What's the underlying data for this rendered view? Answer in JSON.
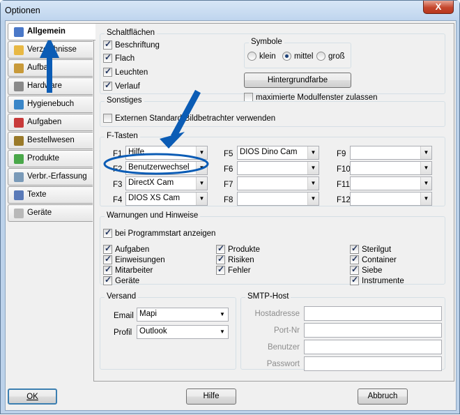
{
  "window": {
    "title": "Optionen",
    "close_glyph": "X"
  },
  "tabs": [
    {
      "label": "Allgemein",
      "icon": "checkmark-document-icon",
      "color": "#4a78c8"
    },
    {
      "label": "Verzeichnisse",
      "icon": "folder-icon",
      "color": "#e8b844"
    },
    {
      "label": "Aufbau",
      "icon": "download-icon",
      "color": "#c89a3a"
    },
    {
      "label": "Hardware",
      "icon": "gear-icon",
      "color": "#8a8a8a"
    },
    {
      "label": "Hygienebuch",
      "icon": "globe-icon",
      "color": "#3a86c8"
    },
    {
      "label": "Aufgaben",
      "icon": "flag-icon",
      "color": "#c83a3a"
    },
    {
      "label": "Bestellwesen",
      "icon": "box-icon",
      "color": "#9a7a2a"
    },
    {
      "label": "Produkte",
      "icon": "cube-icon",
      "color": "#4aa84a"
    },
    {
      "label": "Verbr.-Erfassung",
      "icon": "cart-icon",
      "color": "#7a9ab8"
    },
    {
      "label": "Texte",
      "icon": "document-icon",
      "color": "#5a7ab8"
    },
    {
      "label": "Geräte",
      "icon": "device-icon",
      "color": "#b8b8b8"
    }
  ],
  "schalt": {
    "title": "Schaltflächen",
    "items": [
      {
        "label": "Beschriftung",
        "checked": true
      },
      {
        "label": "Flach",
        "checked": true
      },
      {
        "label": "Leuchten",
        "checked": true
      },
      {
        "label": "Verlauf",
        "checked": true
      }
    ]
  },
  "symbole": {
    "title": "Symbole",
    "options": [
      {
        "label": "klein",
        "selected": false
      },
      {
        "label": "mittel",
        "selected": true
      },
      {
        "label": "groß",
        "selected": false
      }
    ]
  },
  "hintergrund": "Hintergrundfarbe",
  "modulfenster": {
    "label": "maximierte Modulfenster zulassen",
    "checked": false
  },
  "sonstiges": {
    "title": "Sonstiges",
    "item": "Externen Standard-Bildbetrachter verwenden"
  },
  "ftasten": {
    "title": "F-Tasten",
    "keys": [
      {
        "key": "F1",
        "value": "Hilfe"
      },
      {
        "key": "F2",
        "value": "Benutzerwechsel"
      },
      {
        "key": "F3",
        "value": "DirectX Cam"
      },
      {
        "key": "F4",
        "value": "DIOS XS Cam"
      },
      {
        "key": "F5",
        "value": "DIOS Dino Cam"
      },
      {
        "key": "F6",
        "value": ""
      },
      {
        "key": "F7",
        "value": ""
      },
      {
        "key": "F8",
        "value": ""
      },
      {
        "key": "F9",
        "value": ""
      },
      {
        "key": "F10",
        "value": ""
      },
      {
        "key": "F11",
        "value": ""
      },
      {
        "key": "F12",
        "value": ""
      }
    ]
  },
  "warn": {
    "title": "Warnungen und Hinweise",
    "start": "bei Programmstart anzeigen",
    "items": [
      "Aufgaben",
      "Einweisungen",
      "Mitarbeiter",
      "Geräte",
      "Produkte",
      "Risiken",
      "Fehler",
      "Sterilgut",
      "Container",
      "Siebe",
      "Instrumente"
    ]
  },
  "versand": {
    "title": "Versand",
    "email_label": "Email",
    "email_value": "Mapi",
    "profil_label": "Profil",
    "profil_value": "Outlook"
  },
  "smtp": {
    "title": "SMTP-Host",
    "fields": [
      "Hostadresse",
      "Port-Nr",
      "Benutzer",
      "Passwort"
    ]
  },
  "buttons": {
    "ok": "OK",
    "hilfe": "Hilfe",
    "abbruch": "Abbruch"
  },
  "accent": "#0b5cb5"
}
